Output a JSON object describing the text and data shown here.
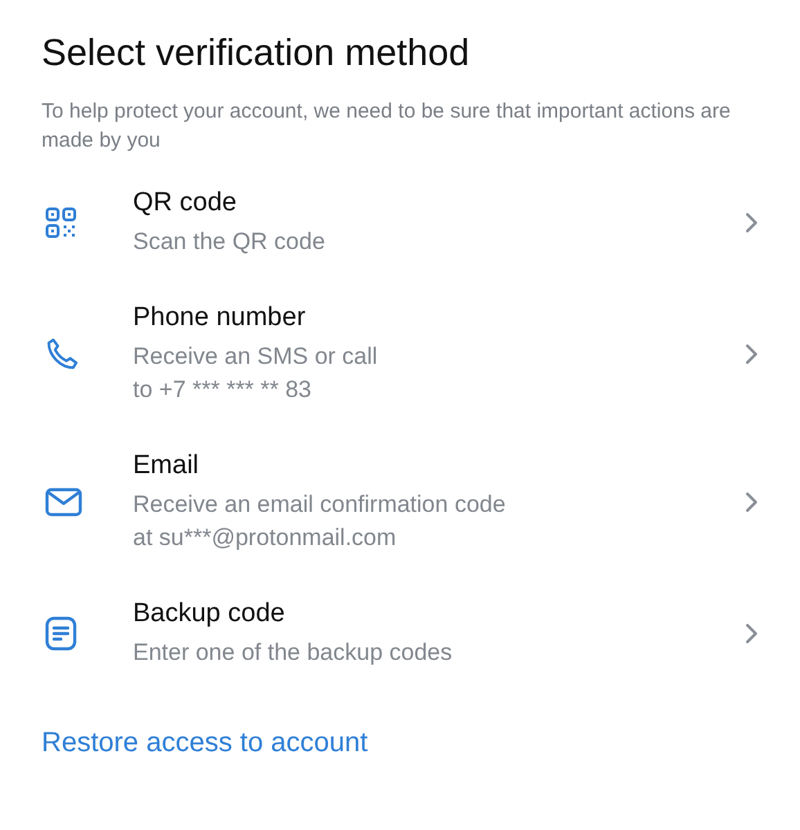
{
  "title": "Select verification method",
  "subtitle": "To help protect your account, we need to be sure that important actions are made by you",
  "methods": [
    {
      "kind": "qr",
      "name": "QR code",
      "description": [
        "Scan the QR code"
      ]
    },
    {
      "kind": "phone",
      "name": "Phone number",
      "description": [
        "Receive an SMS or call",
        "to +7 *** *** ** 83"
      ]
    },
    {
      "kind": "email",
      "name": "Email",
      "description": [
        "Receive an email confirmation code",
        "at su***@protonmail.com"
      ]
    },
    {
      "kind": "backup",
      "name": "Backup code",
      "description": [
        "Enter one of the backup codes"
      ]
    }
  ],
  "restore_link": "Restore access to account"
}
